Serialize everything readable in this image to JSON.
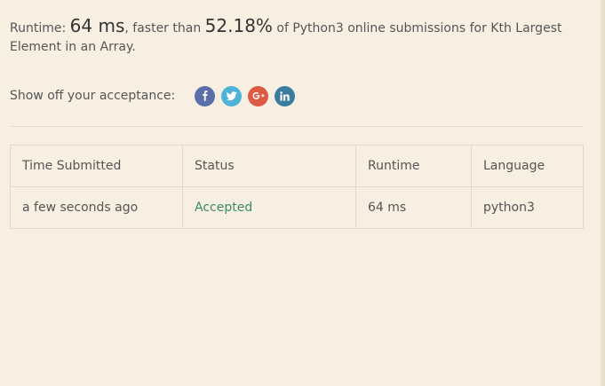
{
  "summary": {
    "runtime_label": "Runtime: ",
    "runtime_value": "64 ms",
    "faster_text": ", faster than ",
    "percentile_value": "52.18%",
    "tail_text": " of Python3 online submissions for Kth Largest Element in an Array."
  },
  "share": {
    "label": "Show off your acceptance:",
    "icons": [
      "facebook-icon",
      "twitter-icon",
      "google-plus-icon",
      "linkedin-icon"
    ]
  },
  "table": {
    "headers": [
      "Time Submitted",
      "Status",
      "Runtime",
      "Language"
    ],
    "rows": [
      {
        "time": "a few seconds ago",
        "status": "Accepted",
        "runtime": "64 ms",
        "language": "python3"
      }
    ]
  },
  "colors": {
    "background": "#f7f0e2",
    "accepted": "#3c8a5a",
    "facebook": "#5a6ea7",
    "twitter": "#4fb3d9",
    "google_plus": "#dd5a44",
    "linkedin": "#3a7c9e"
  }
}
